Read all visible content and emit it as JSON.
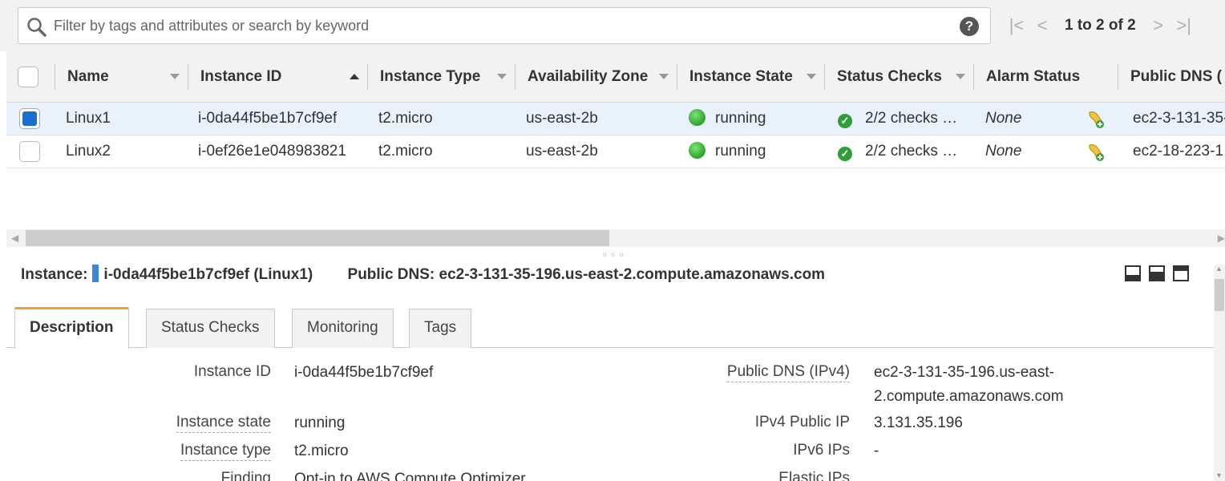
{
  "filter": {
    "placeholder": "Filter by tags and attributes or search by keyword",
    "help_icon_label": "?"
  },
  "pagination": {
    "label": "1 to 2 of 2",
    "first_symbol": "|<",
    "prev_symbol": "<",
    "next_symbol": ">",
    "last_symbol": ">|"
  },
  "table": {
    "columns": [
      {
        "label": "Name",
        "sortable": true
      },
      {
        "label": "Instance ID",
        "sortable": true,
        "sorted": "asc"
      },
      {
        "label": "Instance Type",
        "sortable": true
      },
      {
        "label": "Availability Zone",
        "sortable": true
      },
      {
        "label": "Instance State",
        "sortable": true
      },
      {
        "label": "Status Checks",
        "sortable": true
      },
      {
        "label": "Alarm Status",
        "sortable": false
      },
      {
        "label": "Public DNS (",
        "sortable": false
      }
    ],
    "rows": [
      {
        "selected": true,
        "name": "Linux1",
        "instance_id": "i-0da44f5be1b7cf9ef",
        "instance_type": "t2.micro",
        "availability_zone": "us-east-2b",
        "instance_state": "running",
        "status_checks": "2/2 checks …",
        "alarm_status": "None",
        "public_dns": "ec2-3-131-35-"
      },
      {
        "selected": false,
        "name": "Linux2",
        "instance_id": "i-0ef26e1e048983821",
        "instance_type": "t2.micro",
        "availability_zone": "us-east-2b",
        "instance_state": "running",
        "status_checks": "2/2 checks …",
        "alarm_status": "None",
        "public_dns": "ec2-18-223-1"
      }
    ]
  },
  "details": {
    "instance_prefix": "Instance:",
    "instance_value": "i-0da44f5be1b7cf9ef (Linux1)",
    "public_dns_title": "Public DNS: ec2-3-131-35-196.us-east-2.compute.amazonaws.com",
    "tabs": [
      "Description",
      "Status Checks",
      "Monitoring",
      "Tags"
    ],
    "active_tab": "Description",
    "left_fields": [
      {
        "label": "Instance ID",
        "value": "i-0da44f5be1b7cf9ef"
      },
      {
        "label": "Instance state",
        "value": "running"
      },
      {
        "label": "Instance type",
        "value": "t2.micro"
      },
      {
        "label": "Finding",
        "value": "Opt-in to AWS Compute Optimizer"
      }
    ],
    "right_fields": [
      {
        "label": "Public DNS (IPv4)",
        "value": "ec2-3-131-35-196.us-east-",
        "value2": "2.compute.amazonaws.com"
      },
      {
        "label": "IPv4 Public IP",
        "value": "3.131.35.196"
      },
      {
        "label": "IPv6 IPs",
        "value": "-"
      },
      {
        "label": "Elastic IPs",
        "value": ""
      }
    ]
  },
  "colors": {
    "accent_tab": "#f0a030",
    "selection_blue": "#1b6fce",
    "running_green": "#2aa526",
    "row_selected_bg": "#e9f1fb"
  }
}
